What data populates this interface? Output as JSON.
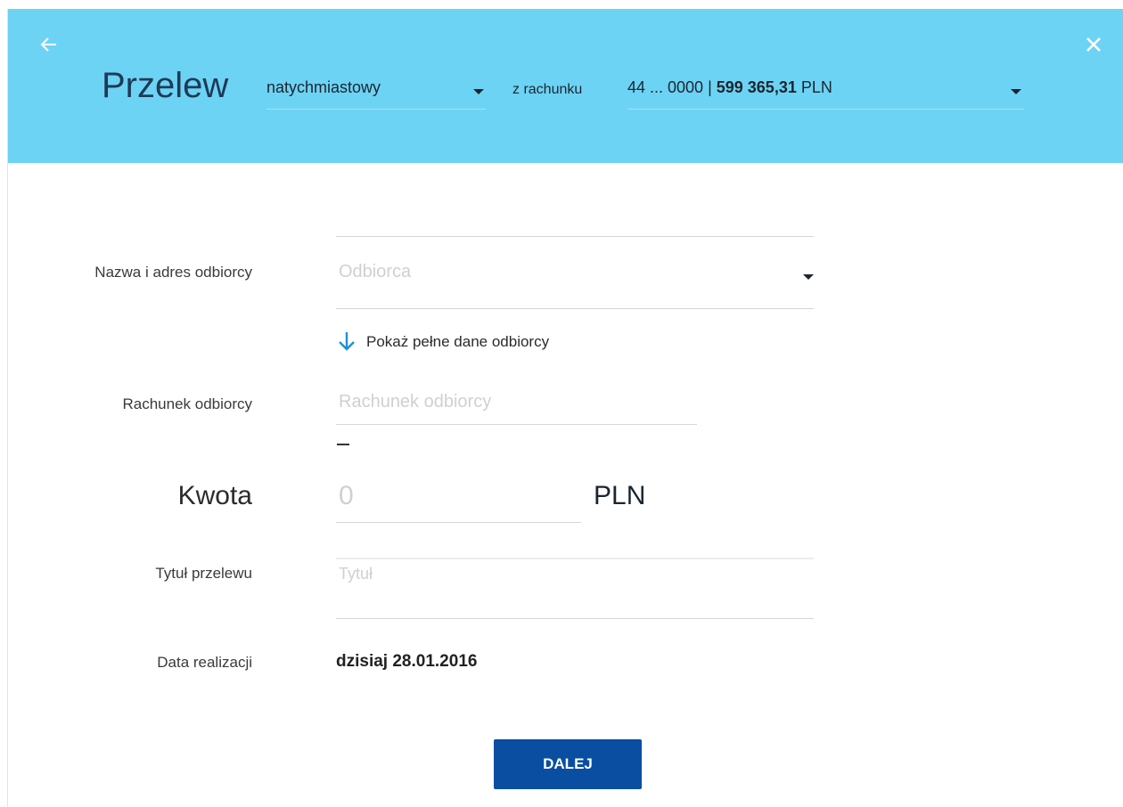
{
  "header": {
    "title": "Przelew",
    "transfer_type": "natychmiastowy",
    "from_label": "z rachunku",
    "account_prefix": "44 ... 0000 | ",
    "account_balance": "599 365,31",
    "account_currency": "PLN",
    "bg_color": "#6dd3f4"
  },
  "form": {
    "recipient_label": "Nazwa i adres odbiorcy",
    "recipient_placeholder": "Odbiorca",
    "show_more_label": "Pokaż pełne dane odbiorcy",
    "account_label": "Rachunek odbiorcy",
    "account_placeholder": "Rachunek odbiorcy",
    "amount_label": "Kwota",
    "amount_placeholder": "0",
    "currency": "PLN",
    "title_label": "Tytuł przelewu",
    "title_placeholder": "Tytuł",
    "date_label": "Data realizacji",
    "date_value": "dzisiaj 28.01.2016"
  },
  "actions": {
    "next_label": "DALEJ",
    "next_color": "#0a4ea1"
  },
  "icons": {
    "back": "arrow-left-icon",
    "close": "close-icon",
    "show_more": "arrow-down-icon"
  }
}
